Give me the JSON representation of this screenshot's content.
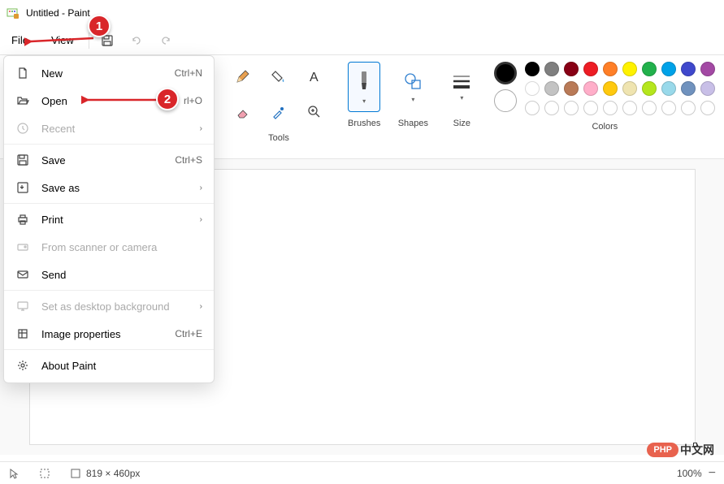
{
  "title": "Untitled - Paint",
  "menubar": {
    "file": "File",
    "view": "View"
  },
  "dropdown": {
    "new": {
      "label": "New",
      "shortcut": "Ctrl+N"
    },
    "open": {
      "label": "Open",
      "shortcut": "rl+O"
    },
    "recent": {
      "label": "Recent"
    },
    "save": {
      "label": "Save",
      "shortcut": "Ctrl+S"
    },
    "saveas": {
      "label": "Save as"
    },
    "print": {
      "label": "Print"
    },
    "scanner": {
      "label": "From scanner or camera"
    },
    "send": {
      "label": "Send"
    },
    "desktop": {
      "label": "Set as desktop background"
    },
    "props": {
      "label": "Image properties",
      "shortcut": "Ctrl+E"
    },
    "about": {
      "label": "About Paint"
    }
  },
  "ribbon": {
    "tools_label": "Tools",
    "brushes_label": "Brushes",
    "shapes_label": "Shapes",
    "size_label": "Size",
    "colors_label": "Colors"
  },
  "colors": {
    "primary": "#000000",
    "secondary": "#ffffff",
    "row1": [
      "#000000",
      "#7f7f7f",
      "#880015",
      "#ed1c24",
      "#ff7f27",
      "#fff200",
      "#22b14c",
      "#00a2e8",
      "#3f48cc",
      "#a349a4"
    ],
    "row2": [
      "#ffffff",
      "#c3c3c3",
      "#b97a57",
      "#ffaec9",
      "#ffc90e",
      "#efe4b0",
      "#b5e61d",
      "#99d9ea",
      "#7092be",
      "#c8bfe7"
    ]
  },
  "status": {
    "dimensions": "819 × 460px",
    "zoom": "100%"
  },
  "annotations": {
    "one": "1",
    "two": "2"
  },
  "watermark": {
    "pill": "PHP",
    "text": "中文网"
  }
}
